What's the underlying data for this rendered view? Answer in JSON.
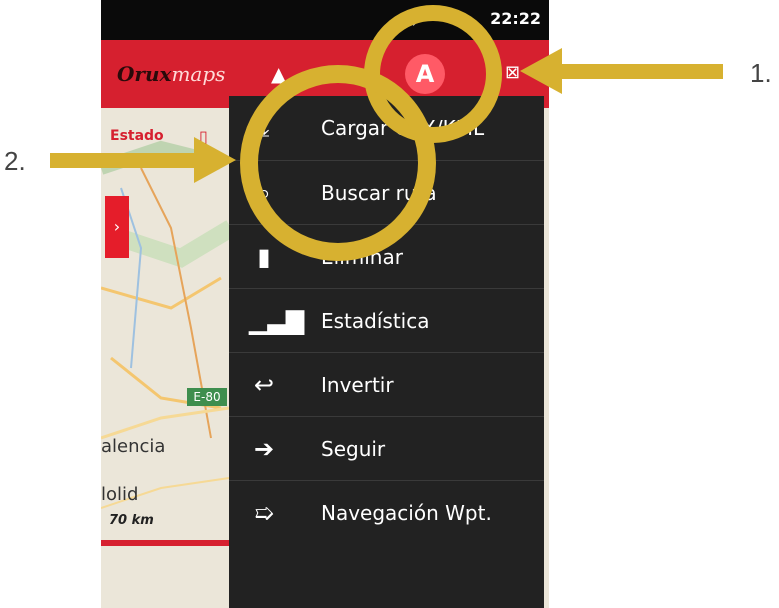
{
  "status_bar": {
    "time": "22:22",
    "icons": [
      "bluetooth-icon",
      "wifi-icon"
    ]
  },
  "action_bar": {
    "logo_part1": "Orux",
    "logo_part2": "maps",
    "highlighted_button": "A"
  },
  "map": {
    "status_label": "Estado",
    "road_badge": "E-80",
    "places": [
      "alencia",
      "lolid"
    ],
    "scale": "70 km"
  },
  "menu": {
    "items": [
      {
        "label": "Cargar GPX/KML",
        "icon": "download-icon"
      },
      {
        "label": "Buscar ruta",
        "icon": "search-icon"
      },
      {
        "label": "Eliminar",
        "icon": "trash-icon"
      },
      {
        "label": "Estadística",
        "icon": "bar-chart-icon"
      },
      {
        "label": "Invertir",
        "icon": "undo-icon"
      },
      {
        "label": "Seguir",
        "icon": "follow-arrow-icon"
      },
      {
        "label": "Navegación Wpt.",
        "icon": "waypoint-navigation-icon"
      }
    ]
  },
  "annotations": {
    "label_1": "1.",
    "label_2": "2.",
    "highlight_color": "#d7b130"
  },
  "colors": {
    "action_bar": "#d6202f",
    "menu_background": "#222222",
    "status_bar": "#0a0a0a"
  }
}
